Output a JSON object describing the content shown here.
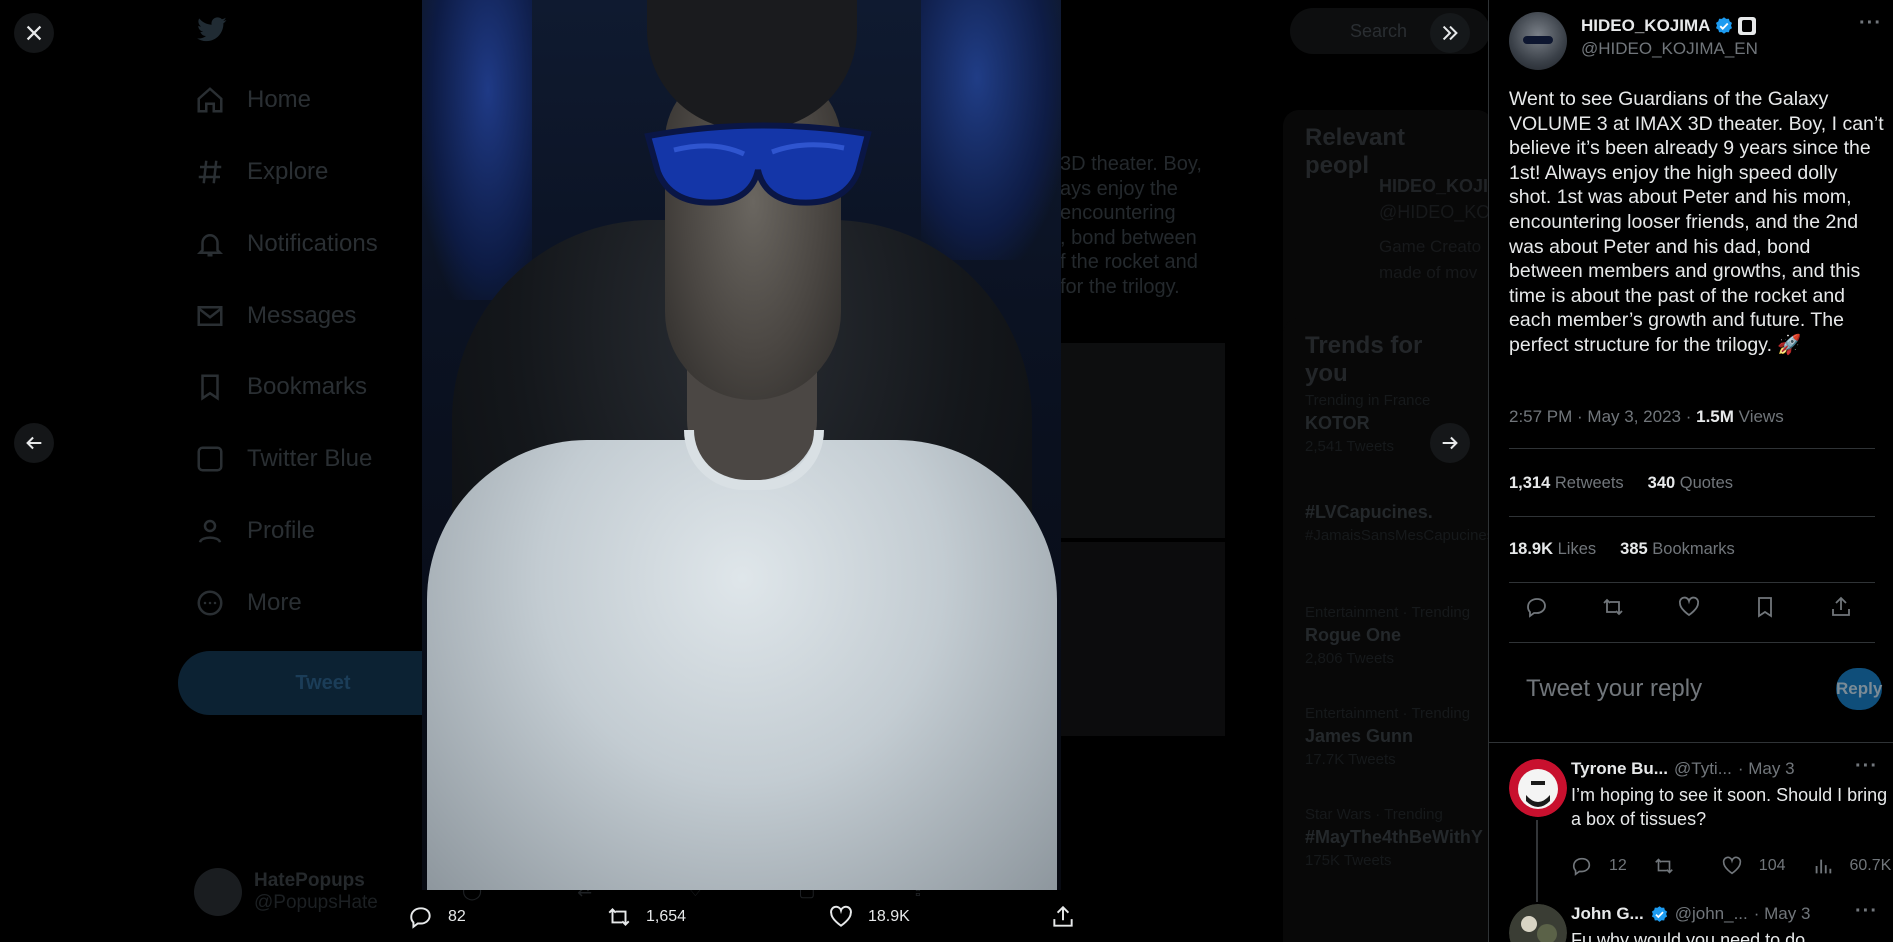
{
  "background": {
    "nav": [
      "Home",
      "Explore",
      "Notifications",
      "Messages",
      "Bookmarks",
      "Twitter Blue",
      "Profile",
      "More"
    ],
    "tweet_button": "Tweet",
    "user_name": "HatePopups",
    "user_handle": "@PopupsHate",
    "search_placeholder": "Search",
    "relevant_title": "Relevant peopl",
    "relevant_name": "HIDEO_KOJIM",
    "relevant_handle": "@HIDEO_KO",
    "relevant_bio": "Game Creato\nmade of mov",
    "trends_title": "Trends for you",
    "trends": [
      {
        "meta": "Trending in France",
        "name": "KOTOR",
        "count": "2,541 Tweets"
      },
      {
        "meta": "",
        "name": "#LVCapucines.",
        "count": "#JamaisSansMesCapucines"
      },
      {
        "meta": "Entertainment · Trending",
        "name": "Rogue One",
        "count": "2,806 Tweets"
      },
      {
        "meta": "Entertainment · Trending",
        "name": "James Gunn",
        "count": "17.7K Tweets"
      },
      {
        "meta": "Star Wars · Trending",
        "name": "#MayThe4thBeWithY",
        "count": "175K Tweets"
      }
    ],
    "partial_text": "3D theater. Boy,\nays enjoy the\nencountering\n, bond between\nf the rocket and\n for the trilogy."
  },
  "viewer": {
    "close_icon": "close-icon",
    "collapse_icon": "double-chevron-right-icon",
    "prev_icon": "arrow-left-icon",
    "next_icon": "arrow-right-icon",
    "photo_alt": "Selfie in IMAX theater wearing blue 3D glasses",
    "bottom": {
      "replies": "82",
      "retweets": "1,654",
      "likes": "18.9K"
    }
  },
  "tweet": {
    "author_name": "HIDEO_KOJIMA",
    "author_handle": "@HIDEO_KOJIMA_EN",
    "text": "Went to see Guardians of the Galaxy VOLUME 3 at IMAX 3D theater. Boy, I can’t believe it’s been already 9 years since the 1st! Always enjoy the high speed dolly shot. 1st was about Peter and his mom, encountering looser friends, and the 2nd was about Peter and his dad, bond between members and growths, and this time is about the past of the rocket and each member’s growth and future. The perfect structure for the trilogy. 🚀",
    "time": "2:57 PM · May 3, 2023",
    "sep": "·",
    "views_count": "1.5M",
    "views_label": "Views",
    "retweets_count": "1,314",
    "retweets_label": "Retweets",
    "quotes_count": "340",
    "quotes_label": "Quotes",
    "likes_count": "18.9K",
    "likes_label": "Likes",
    "bookmarks_count": "385",
    "bookmarks_label": "Bookmarks"
  },
  "reply_box": {
    "placeholder": "Tweet your reply",
    "button": "Reply"
  },
  "replies": [
    {
      "name": "Tyrone Bu...",
      "handle": "@Tyti...",
      "date": "· May 3",
      "text": "I’m hoping to see it soon. Should I bring a box of tissues?",
      "replies": "12",
      "retweets": "",
      "likes": "104",
      "views": "60.7K"
    },
    {
      "name": "John G...",
      "handle": "@john_...",
      "date": "· May 3",
      "text": "Fu why would you need to do",
      "replies": "",
      "retweets": "",
      "likes": "",
      "views": ""
    }
  ],
  "colors": {
    "accent": "#1d9bf0",
    "reply_button_dim": "#0f4e7a",
    "muted_text": "#71767b",
    "primary_text": "#e7e9ea"
  }
}
